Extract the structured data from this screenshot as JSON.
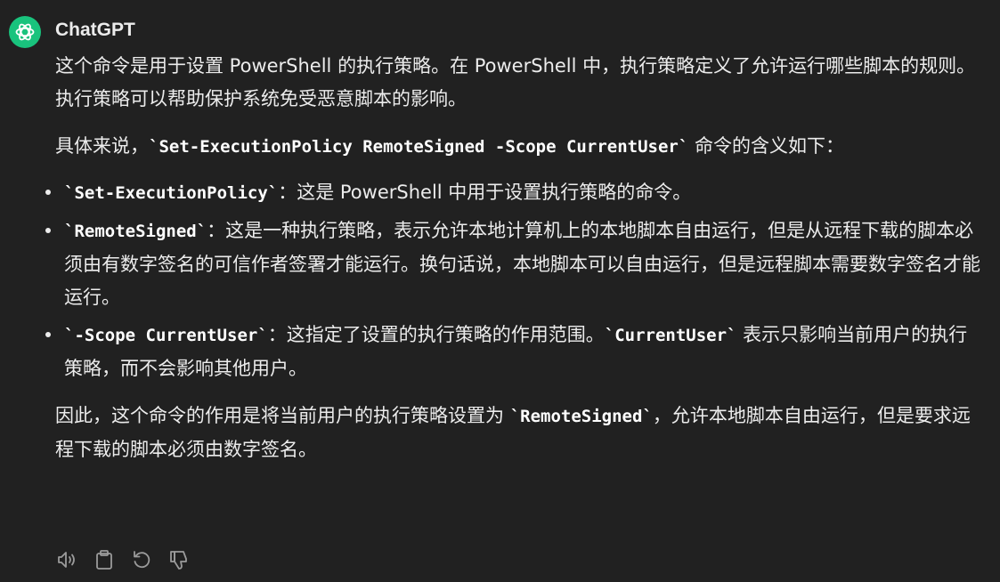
{
  "message": {
    "sender": "ChatGPT",
    "intro": "这个命令是用于设置 PowerShell 的执行策略。在 PowerShell 中，执行策略定义了允许运行哪些脚本的规则。执行策略可以帮助保护系统免受恶意脚本的影响。",
    "lead_text": "具体来说，",
    "lead_code": "`Set-ExecutionPolicy RemoteSigned -Scope CurrentUser`",
    "lead_tail": " 命令的含义如下：",
    "items": [
      {
        "code": "`Set-ExecutionPolicy`",
        "text": "：这是 PowerShell 中用于设置执行策略的命令。"
      },
      {
        "code": "`RemoteSigned`",
        "text": "：这是一种执行策略，表示允许本地计算机上的本地脚本自由运行，但是从远程下载的脚本必须由有数字签名的可信作者签署才能运行。换句话说，本地脚本可以自由运行，但是远程脚本需要数字签名才能运行。"
      },
      {
        "code": "`-Scope CurrentUser`",
        "text": "：这指定了设置的执行策略的作用范围。",
        "code2": "`CurrentUser`",
        "text2": " 表示只影响当前用户的执行策略，而不会影响其他用户。"
      }
    ],
    "conclusion_text": "因此，这个命令的作用是将当前用户的执行策略设置为 ",
    "conclusion_code": "`RemoteSigned`",
    "conclusion_tail": "，允许本地脚本自由运行，但是要求远程下载的脚本必须由数字签名。"
  },
  "actions": [
    {
      "icon": "speaker-icon"
    },
    {
      "icon": "clipboard-icon"
    },
    {
      "icon": "regenerate-icon"
    },
    {
      "icon": "thumbs-down-icon"
    }
  ],
  "colors": {
    "background": "#212121",
    "text": "#ececec",
    "avatar": "#19c37d",
    "icon": "#9b9b9b"
  }
}
